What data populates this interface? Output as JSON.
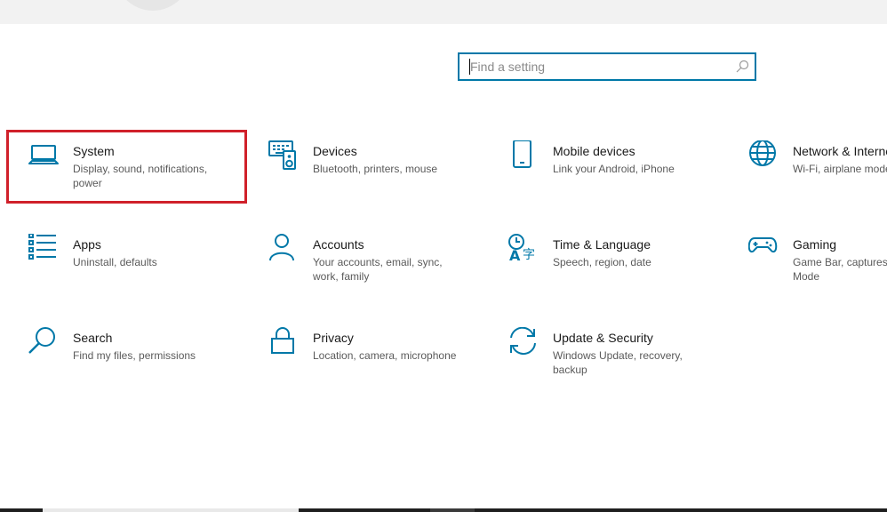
{
  "search": {
    "placeholder": "Find a setting"
  },
  "colors": {
    "accent": "#0078a8",
    "highlight": "#d0202a"
  },
  "categories": [
    {
      "id": "system",
      "icon": "laptop-icon",
      "title": "System",
      "desc": "Display, sound, notifications, power"
    },
    {
      "id": "devices",
      "icon": "keyboard-speaker-icon",
      "title": "Devices",
      "desc": "Bluetooth, printers, mouse"
    },
    {
      "id": "mobile-devices",
      "icon": "phone-icon",
      "title": "Mobile devices",
      "desc": "Link your Android, iPhone"
    },
    {
      "id": "network",
      "icon": "globe-icon",
      "title": "Network & Internet",
      "desc": "Wi-Fi, airplane mode, VPN"
    },
    {
      "id": "apps",
      "icon": "apps-list-icon",
      "title": "Apps",
      "desc": "Uninstall, defaults"
    },
    {
      "id": "accounts",
      "icon": "person-icon",
      "title": "Accounts",
      "desc": "Your accounts, email, sync, work, family"
    },
    {
      "id": "time-language",
      "icon": "time-language-icon",
      "title": "Time & Language",
      "desc": "Speech, region, date"
    },
    {
      "id": "gaming",
      "icon": "gamepad-icon",
      "title": "Gaming",
      "desc": "Game Bar, captures, Game Mode"
    },
    {
      "id": "search",
      "icon": "magnifier-icon",
      "title": "Search",
      "desc": "Find my files, permissions"
    },
    {
      "id": "privacy",
      "icon": "lock-icon",
      "title": "Privacy",
      "desc": "Location, camera, microphone"
    },
    {
      "id": "update-security",
      "icon": "sync-arrows-icon",
      "title": "Update & Security",
      "desc": "Windows Update, recovery, backup"
    }
  ]
}
